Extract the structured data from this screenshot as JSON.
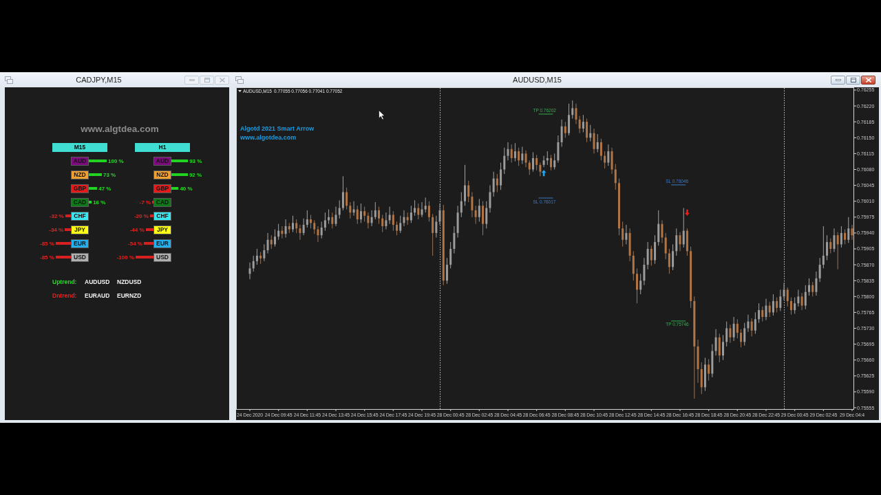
{
  "strength_window": {
    "title": "CADJPY,M15",
    "active": false,
    "site": "www.algtdea.com",
    "timeframes": [
      {
        "label": "M15",
        "currencies": [
          {
            "code": "AUD",
            "color": "#7d0a7d",
            "kind": "gain",
            "level": 1,
            "reading": "100 %"
          },
          {
            "code": "NZD",
            "color": "#f0a030",
            "kind": "gain",
            "level": 0.73,
            "reading": "73 %"
          },
          {
            "code": "GBP",
            "color": "#e51a1a",
            "kind": "gain",
            "level": 0.47,
            "reading": "47 %"
          },
          {
            "code": "CAD",
            "color": "#0d7a1a",
            "kind": "gain",
            "level": 0.16,
            "reading": "16 %"
          },
          {
            "code": "CHF",
            "color": "#3ae6f0",
            "kind": "loss",
            "level": 0.32,
            "reading": "-32 %"
          },
          {
            "code": "JPY",
            "color": "#ffff14",
            "kind": "loss",
            "level": 0.34,
            "reading": "-34 %"
          },
          {
            "code": "EUR",
            "color": "#22b0ee",
            "kind": "loss",
            "level": 0.85,
            "reading": "-85 %"
          },
          {
            "code": "USD",
            "color": "#b0b0b0",
            "kind": "loss",
            "level": 0.85,
            "reading": "-85 %"
          }
        ]
      },
      {
        "label": "H1",
        "currencies": [
          {
            "code": "AUD",
            "color": "#7d0a7d",
            "kind": "gain",
            "level": 0.93,
            "reading": "93 %"
          },
          {
            "code": "NZD",
            "color": "#f0a030",
            "kind": "gain",
            "level": 0.92,
            "reading": "92 %"
          },
          {
            "code": "GBP",
            "color": "#e51a1a",
            "kind": "gain",
            "level": 0.4,
            "reading": "40 %"
          },
          {
            "code": "CAD",
            "color": "#0d7a1a",
            "kind": "loss",
            "level": 0.07,
            "reading": "-7 %"
          },
          {
            "code": "CHF",
            "color": "#3ae6f0",
            "kind": "loss",
            "level": 0.2,
            "reading": "-20 %"
          },
          {
            "code": "JPY",
            "color": "#ffff14",
            "kind": "loss",
            "level": 0.44,
            "reading": "-44 %"
          },
          {
            "code": "EUR",
            "color": "#22b0ee",
            "kind": "loss",
            "level": 0.54,
            "reading": "-54 %"
          },
          {
            "code": "USD",
            "color": "#b0b0b0",
            "kind": "loss",
            "level": 1,
            "reading": "-100 %"
          }
        ]
      }
    ],
    "trends": [
      {
        "label": "Uptrend:",
        "kind": "up",
        "pairs": [
          "AUDUSD",
          "NZDUSD"
        ]
      },
      {
        "label": "Dntrend:",
        "kind": "down",
        "pairs": [
          "EURAUD",
          "EURNZD"
        ]
      }
    ]
  },
  "chart_window": {
    "title": "AUDUSD,M15",
    "active": true,
    "header": {
      "symbol": "AUDUSD,M15",
      "quotes": "0.77055 0.77056 0.77041 0.77052"
    },
    "indicator_lines": [
      "Algotd 2021 Smart Arrow",
      "www.algotdea.com"
    ],
    "chart_data": [
      {
        "type": "candlestick",
        "ylim": [
          0.75552,
          0.76261
        ],
        "yticks": [
          0.76255,
          {
            "value": 0.7622,
            "label": "0.76220"
          },
          0.76185,
          {
            "value": 0.7615,
            "label": "0.76150"
          },
          0.76115,
          {
            "value": 0.7608,
            "label": "0.76080"
          },
          0.76045,
          {
            "value": 0.7601,
            "label": "0.76010"
          },
          0.75975,
          {
            "value": 0.7594,
            "label": "0.75940"
          },
          0.75905,
          {
            "value": 0.7587,
            "label": "0.75870"
          },
          0.75835,
          {
            "value": 0.758,
            "label": "0.75800"
          },
          0.75765,
          {
            "value": 0.7573,
            "label": "0.75730"
          },
          0.75695,
          {
            "value": 0.7566,
            "label": "0.75660"
          },
          0.75625,
          {
            "value": 0.7559,
            "label": "0.75590"
          },
          0.75555
        ],
        "categories": [
          "24 Dec 2020",
          null,
          null,
          null,
          null,
          null,
          null,
          null,
          "24 Dec 09:45",
          null,
          null,
          null,
          null,
          null,
          null,
          null,
          "24 Dec 11:45",
          null,
          null,
          null,
          null,
          null,
          null,
          null,
          "24 Dec 13:45",
          null,
          null,
          null,
          null,
          null,
          null,
          null,
          "24 Dec 15:45",
          null,
          null,
          null,
          null,
          null,
          null,
          null,
          "24 Dec 17:45",
          null,
          null,
          null,
          null,
          null,
          null,
          null,
          "24 Dec 19:45",
          null,
          null,
          null,
          null,
          null,
          null,
          null,
          "28 Dec 00:45",
          null,
          null,
          null,
          null,
          null,
          null,
          null,
          "28 Dec 02:45",
          null,
          null,
          null,
          null,
          null,
          null,
          null,
          "28 Dec 04:45",
          null,
          null,
          null,
          null,
          null,
          null,
          null,
          "28 Dec 06:45",
          null,
          null,
          null,
          null,
          null,
          null,
          null,
          "28 Dec 08:45",
          null,
          null,
          null,
          null,
          null,
          null,
          null,
          "28 Dec 10:45",
          null,
          null,
          null,
          null,
          null,
          null,
          null,
          "28 Dec 12:45",
          null,
          null,
          null,
          null,
          null,
          null,
          null,
          "28 Dec 14:45",
          null,
          null,
          null,
          null,
          null,
          null,
          null,
          "28 Dec 16:45",
          null,
          null,
          null,
          null,
          null,
          null,
          null,
          "28 Dec 18:45",
          null,
          null,
          null,
          null,
          null,
          null,
          null,
          "28 Dec 20:45",
          null,
          null,
          null,
          null,
          null,
          null,
          null,
          "28 Dec 22:45",
          null,
          null,
          null,
          null,
          null,
          null,
          null,
          "29 Dec 00:45",
          null,
          null,
          null,
          null,
          null,
          null,
          null,
          "29 Dec 02:45",
          null,
          null,
          null,
          null,
          null,
          null,
          null,
          "29 Dec 04:4"
        ],
        "ohlc": [
          [
            0.7585,
            0.75875,
            0.75838,
            0.75862
          ],
          [
            0.75862,
            0.7589,
            0.75855,
            0.75878
          ],
          [
            0.75878,
            0.75905,
            0.7587,
            0.7589
          ],
          [
            0.7589,
            0.75898,
            0.75872,
            0.75884
          ],
          [
            0.75884,
            0.75915,
            0.75878,
            0.75902
          ],
          [
            0.75902,
            0.7594,
            0.75895,
            0.75925
          ],
          [
            0.75925,
            0.75935,
            0.75905,
            0.75915
          ],
          [
            0.75915,
            0.75948,
            0.7591,
            0.75932
          ],
          [
            0.75932,
            0.7596,
            0.75925,
            0.75945
          ],
          [
            0.75945,
            0.75955,
            0.75928,
            0.75938
          ],
          [
            0.75938,
            0.7597,
            0.7593,
            0.75955
          ],
          [
            0.75955,
            0.75962,
            0.7594,
            0.75948
          ],
          [
            0.75948,
            0.75978,
            0.75942,
            0.75962
          ],
          [
            0.75962,
            0.7597,
            0.7594,
            0.7595
          ],
          [
            0.7595,
            0.75958,
            0.75925,
            0.7594
          ],
          [
            0.7594,
            0.75972,
            0.75935,
            0.75958
          ],
          [
            0.75958,
            0.7599,
            0.75952,
            0.7597
          ],
          [
            0.7597,
            0.7598,
            0.7595,
            0.75962
          ],
          [
            0.75962,
            0.75968,
            0.75938,
            0.75948
          ],
          [
            0.75948,
            0.75955,
            0.7592,
            0.75935
          ],
          [
            0.75935,
            0.75965,
            0.75928,
            0.75952
          ],
          [
            0.75952,
            0.75985,
            0.75945,
            0.75968
          ],
          [
            0.75968,
            0.75992,
            0.7596,
            0.75975
          ],
          [
            0.75975,
            0.75985,
            0.7595,
            0.7596
          ],
          [
            0.7596,
            0.75998,
            0.75955,
            0.7598
          ],
          [
            0.7598,
            0.76012,
            0.75972,
            0.75995
          ],
          [
            0.75995,
            0.76065,
            0.7599,
            0.7603
          ],
          [
            0.7603,
            0.7604,
            0.75992,
            0.76
          ],
          [
            0.76,
            0.76008,
            0.75972,
            0.75985
          ],
          [
            0.75985,
            0.7601,
            0.75978,
            0.75992
          ],
          [
            0.75992,
            0.76,
            0.7596,
            0.7597
          ],
          [
            0.7597,
            0.76005,
            0.75962,
            0.75988
          ],
          [
            0.75988,
            0.75998,
            0.75965,
            0.75978
          ],
          [
            0.75978,
            0.75985,
            0.7595,
            0.75962
          ],
          [
            0.75962,
            0.7599,
            0.75955,
            0.75975
          ],
          [
            0.75975,
            0.76008,
            0.7597,
            0.7599
          ],
          [
            0.7599,
            0.75998,
            0.7596,
            0.75972
          ],
          [
            0.75972,
            0.7598,
            0.75942,
            0.75955
          ],
          [
            0.75955,
            0.75985,
            0.75948,
            0.75968
          ],
          [
            0.75968,
            0.75998,
            0.7596,
            0.7598
          ],
          [
            0.7598,
            0.75988,
            0.75945,
            0.75958
          ],
          [
            0.75958,
            0.75965,
            0.75935,
            0.75945
          ],
          [
            0.75945,
            0.75978,
            0.7594,
            0.75962
          ],
          [
            0.75962,
            0.7599,
            0.75955,
            0.75975
          ],
          [
            0.75975,
            0.75985,
            0.75958,
            0.75968
          ],
          [
            0.75968,
            0.76,
            0.75962,
            0.75985
          ],
          [
            0.75985,
            0.76012,
            0.75978,
            0.75995
          ],
          [
            0.75995,
            0.76005,
            0.7597,
            0.7598
          ],
          [
            0.7598,
            0.76008,
            0.75975,
            0.75992
          ],
          [
            0.75992,
            0.76018,
            0.75985,
            0.76
          ],
          [
            0.76,
            0.7601,
            0.75965,
            0.75975
          ],
          [
            0.75975,
            0.75982,
            0.7589,
            0.7594
          ],
          [
            0.7594,
            0.75978,
            0.7593,
            0.75965
          ],
          [
            0.75965,
            0.76005,
            0.75958,
            0.7599
          ],
          [
            0.7599,
            0.76002,
            0.75825,
            0.75835
          ],
          [
            0.75835,
            0.75885,
            0.75828,
            0.7587
          ],
          [
            0.7587,
            0.7592,
            0.75862,
            0.75905
          ],
          [
            0.75905,
            0.75955,
            0.75895,
            0.7594
          ],
          [
            0.7594,
            0.76,
            0.7593,
            0.75985
          ],
          [
            0.75985,
            0.7603,
            0.75975,
            0.7601
          ],
          [
            0.7601,
            0.7609,
            0.76,
            0.76045
          ],
          [
            0.76045,
            0.76055,
            0.76008,
            0.7602
          ],
          [
            0.7602,
            0.7603,
            0.75975,
            0.7599
          ],
          [
            0.7599,
            0.76,
            0.7596,
            0.75975
          ],
          [
            0.75975,
            0.76015,
            0.75965,
            0.76
          ],
          [
            0.76,
            0.7601,
            0.75935,
            0.7596
          ],
          [
            0.7596,
            0.7601,
            0.7595,
            0.75995
          ],
          [
            0.75995,
            0.76045,
            0.75985,
            0.7603
          ],
          [
            0.7603,
            0.76075,
            0.7602,
            0.7606
          ],
          [
            0.7606,
            0.7607,
            0.7603,
            0.76045
          ],
          [
            0.76045,
            0.76095,
            0.76035,
            0.7608
          ],
          [
            0.7608,
            0.76128,
            0.7607,
            0.7611
          ],
          [
            0.7611,
            0.7614,
            0.761,
            0.76125
          ],
          [
            0.76125,
            0.76135,
            0.76095,
            0.76105
          ],
          [
            0.76105,
            0.76138,
            0.76098,
            0.7612
          ],
          [
            0.7612,
            0.76128,
            0.76088,
            0.761
          ],
          [
            0.761,
            0.7613,
            0.76092,
            0.76115
          ],
          [
            0.76115,
            0.76122,
            0.76085,
            0.76095
          ],
          [
            0.76095,
            0.761,
            0.76068,
            0.7608
          ],
          [
            0.7608,
            0.76118,
            0.76075,
            0.76105
          ],
          [
            0.76105,
            0.76112,
            0.76078,
            0.7609
          ],
          [
            0.7609,
            0.76095,
            0.76065,
            0.76075
          ],
          [
            0.7609,
            0.7611,
            0.76085,
            0.761
          ],
          [
            0.761,
            0.7612,
            0.7609,
            0.76105
          ],
          [
            0.76105,
            0.76112,
            0.76078,
            0.76085
          ],
          [
            0.76085,
            0.76115,
            0.7608,
            0.761
          ],
          [
            0.761,
            0.76155,
            0.76095,
            0.7614
          ],
          [
            0.7614,
            0.7619,
            0.7613,
            0.76175
          ],
          [
            0.76175,
            0.76185,
            0.7615,
            0.7616
          ],
          [
            0.7616,
            0.76225,
            0.76155,
            0.762
          ],
          [
            0.762,
            0.76232,
            0.76192,
            0.76215
          ],
          [
            0.76215,
            0.76225,
            0.7618,
            0.7619
          ],
          [
            0.7619,
            0.76198,
            0.7616,
            0.7617
          ],
          [
            0.7617,
            0.762,
            0.76162,
            0.76185
          ],
          [
            0.76185,
            0.76192,
            0.7614,
            0.7615
          ],
          [
            0.7615,
            0.76178,
            0.76142,
            0.7616
          ],
          [
            0.7616,
            0.7617,
            0.76115,
            0.76125
          ],
          [
            0.76125,
            0.76158,
            0.76118,
            0.7614
          ],
          [
            0.7614,
            0.76148,
            0.761,
            0.7611
          ],
          [
            0.7611,
            0.7612,
            0.76082,
            0.76095
          ],
          [
            0.76095,
            0.76135,
            0.76088,
            0.7612
          ],
          [
            0.7612,
            0.76128,
            0.7607,
            0.7608
          ],
          [
            0.7608,
            0.76092,
            0.76035,
            0.7605
          ],
          [
            0.7605,
            0.7606,
            0.75935,
            0.7595
          ],
          [
            0.7595,
            0.75965,
            0.7591,
            0.75925
          ],
          [
            0.75925,
            0.75958,
            0.75915,
            0.7594
          ],
          [
            0.7594,
            0.7595,
            0.75878,
            0.7589
          ],
          [
            0.7589,
            0.759,
            0.75835,
            0.7585
          ],
          [
            0.7585,
            0.75862,
            0.75785,
            0.75815
          ],
          [
            0.75815,
            0.7585,
            0.75805,
            0.75835
          ],
          [
            0.75835,
            0.75885,
            0.75825,
            0.7587
          ],
          [
            0.7587,
            0.7592,
            0.7586,
            0.75905
          ],
          [
            0.75905,
            0.75912,
            0.75868,
            0.7588
          ],
          [
            0.7588,
            0.75935,
            0.75872,
            0.7592
          ],
          [
            0.7592,
            0.7599,
            0.75912,
            0.7596
          ],
          [
            0.7596,
            0.75968,
            0.75918,
            0.7593
          ],
          [
            0.7593,
            0.7594,
            0.75882,
            0.75895
          ],
          [
            0.75895,
            0.75905,
            0.7585,
            0.75865
          ],
          [
            0.75865,
            0.75915,
            0.75858,
            0.759
          ],
          [
            0.759,
            0.7595,
            0.7589,
            0.75935
          ],
          [
            0.75935,
            0.75942,
            0.759,
            0.75915
          ],
          [
            0.75915,
            0.75995,
            0.75908,
            0.75945
          ],
          [
            0.75945,
            0.7595,
            0.7589,
            0.759
          ],
          [
            0.759,
            0.7591,
            0.75775,
            0.7579
          ],
          [
            0.7579,
            0.758,
            0.75575,
            0.7569
          ],
          [
            0.7569,
            0.75705,
            0.7561,
            0.7564
          ],
          [
            0.7564,
            0.75655,
            0.75585,
            0.756
          ],
          [
            0.756,
            0.75665,
            0.75592,
            0.7565
          ],
          [
            0.7565,
            0.75662,
            0.75615,
            0.7563
          ],
          [
            0.7563,
            0.75695,
            0.75622,
            0.7568
          ],
          [
            0.7568,
            0.75728,
            0.7567,
            0.7571
          ],
          [
            0.7571,
            0.75718,
            0.75655,
            0.7567
          ],
          [
            0.7567,
            0.75715,
            0.7566,
            0.757
          ],
          [
            0.757,
            0.75745,
            0.7569,
            0.7573
          ],
          [
            0.7573,
            0.75738,
            0.75698,
            0.7571
          ],
          [
            0.7571,
            0.75755,
            0.75702,
            0.7574
          ],
          [
            0.7574,
            0.7575,
            0.75708,
            0.7572
          ],
          [
            0.7572,
            0.75728,
            0.75688,
            0.757
          ],
          [
            0.757,
            0.75742,
            0.75692,
            0.7573
          ],
          [
            0.7573,
            0.7576,
            0.75722,
            0.75745
          ],
          [
            0.75745,
            0.75752,
            0.75712,
            0.75725
          ],
          [
            0.75725,
            0.75765,
            0.75718,
            0.7575
          ],
          [
            0.7575,
            0.75785,
            0.75742,
            0.7577
          ],
          [
            0.7577,
            0.75778,
            0.75745,
            0.75755
          ],
          [
            0.75755,
            0.75795,
            0.75748,
            0.7578
          ],
          [
            0.7578,
            0.75788,
            0.75755,
            0.75765
          ],
          [
            0.75765,
            0.75805,
            0.75758,
            0.7579
          ],
          [
            0.7579,
            0.75798,
            0.75765,
            0.75775
          ],
          [
            0.75775,
            0.75815,
            0.75768,
            0.758
          ],
          [
            0.758,
            0.7583,
            0.75792,
            0.75815
          ],
          [
            0.75815,
            0.7582,
            0.75778,
            0.7579
          ],
          [
            0.7579,
            0.75798,
            0.7576,
            0.7577
          ],
          [
            0.7577,
            0.75798,
            0.75762,
            0.75785
          ],
          [
            0.75785,
            0.75815,
            0.75778,
            0.758
          ],
          [
            0.758,
            0.75808,
            0.7577,
            0.7578
          ],
          [
            0.7578,
            0.75825,
            0.75772,
            0.7581
          ],
          [
            0.7581,
            0.7584,
            0.75802,
            0.75825
          ],
          [
            0.75825,
            0.75832,
            0.758,
            0.7581
          ],
          [
            0.7581,
            0.75855,
            0.75802,
            0.7584
          ],
          [
            0.7584,
            0.75885,
            0.75832,
            0.7587
          ],
          [
            0.7587,
            0.75955,
            0.75862,
            0.7589
          ],
          [
            0.7589,
            0.75935,
            0.7588,
            0.7592
          ],
          [
            0.7592,
            0.75928,
            0.75895,
            0.75905
          ],
          [
            0.75905,
            0.7595,
            0.75898,
            0.75935
          ],
          [
            0.75935,
            0.75942,
            0.7586,
            0.75915
          ],
          [
            0.75915,
            0.75955,
            0.75908,
            0.7594
          ],
          [
            0.7594,
            0.75948,
            0.75915,
            0.75925
          ],
          [
            0.75925,
            0.75975,
            0.75918,
            0.7595
          ],
          [
            0.7595,
            0.75958,
            0.75925,
            0.75935
          ]
        ],
        "ref_lines": [
          {
            "axis": "y",
            "value": 0.76202,
            "label": "TP 0.76202",
            "color": "#34b04f"
          },
          {
            "axis": "y",
            "value": 0.76017,
            "label": "SL 0.76017",
            "color": "#3e78c8"
          },
          {
            "axis": "y",
            "value": 0.76046,
            "label": "SL 0.76046",
            "color": "#3e78c8"
          },
          {
            "axis": "y",
            "value": 0.75746,
            "label": "TP 0.75746",
            "color": "#34b04f"
          }
        ]
      }
    ]
  }
}
